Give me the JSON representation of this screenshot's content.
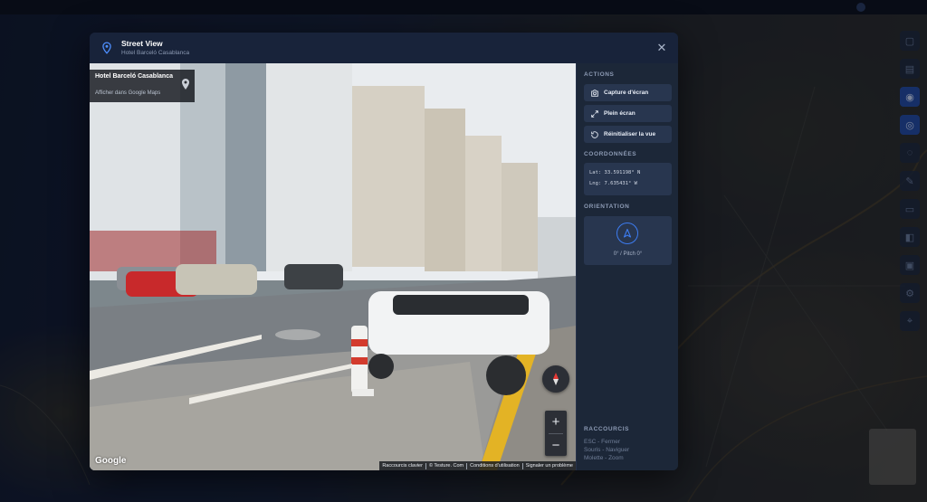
{
  "modal": {
    "title": "Street View",
    "subtitle": "Hotel Barceló Casablanca",
    "close_icon": "close-icon",
    "header_icon": "location-pin-icon"
  },
  "viewer": {
    "place_name": "Hotel Barceló Casablanca",
    "place_link": "Afficher dans Google Maps",
    "google_logo": "Google",
    "zoom_in": "+",
    "zoom_out": "−",
    "attribution": {
      "keyboard": "Raccourcis clavier",
      "copyright": "© Testure. Com",
      "terms": "Conditions d'utilisation",
      "report": "Signaler un problème"
    }
  },
  "sidebar": {
    "actions_title": "ACTIONS",
    "actions": [
      {
        "label": "Capture d'écran",
        "icon": "camera-icon"
      },
      {
        "label": "Plein écran",
        "icon": "expand-icon"
      },
      {
        "label": "Réinitialiser la vue",
        "icon": "reset-icon"
      }
    ],
    "coords_title": "COORDONNÉES",
    "lat": "Lat: 33.591198° N",
    "lng": "Lng: 7.635431° W",
    "orientation_title": "ORIENTATION",
    "orientation_value": "0° / Pitch 0°",
    "shortcuts_title": "RACCOURCIS",
    "shortcuts": [
      "ESC - Fermer",
      "Souris - Naviguer",
      "Molette - Zoom"
    ]
  },
  "colors": {
    "accent": "#3d7cf0",
    "panel": "#1c2738",
    "button": "#28364f"
  }
}
